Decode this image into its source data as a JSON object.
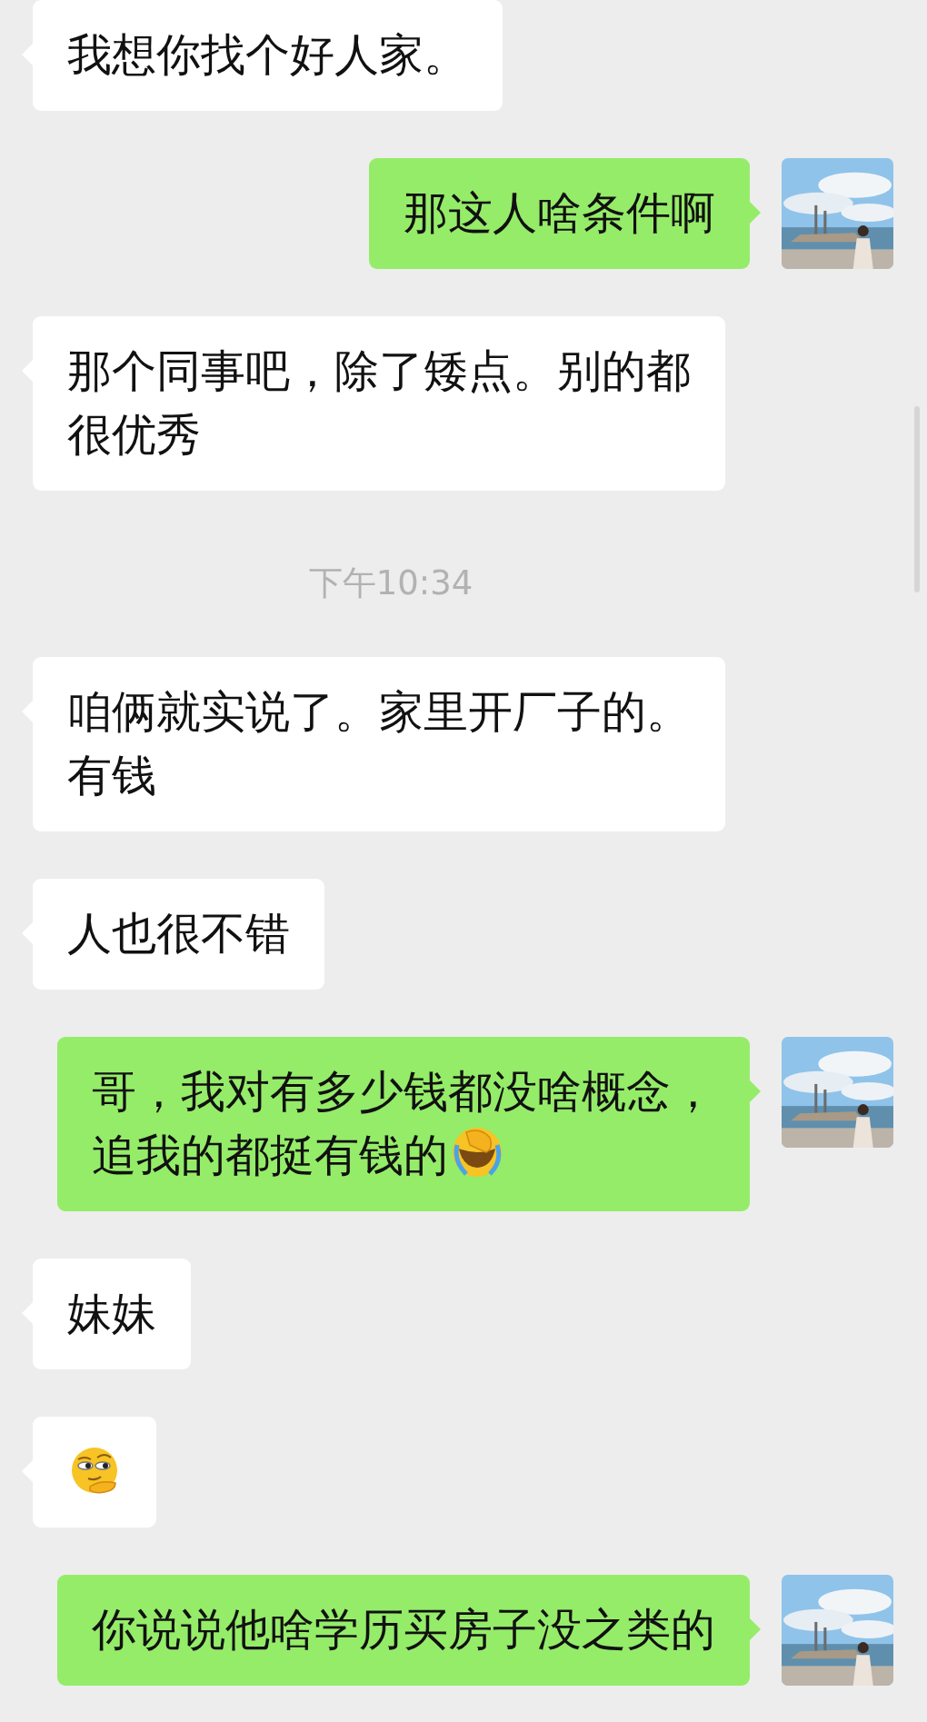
{
  "messages": [
    {
      "kind": "incoming",
      "lines": [
        "我想你找个好人家。"
      ]
    },
    {
      "kind": "outgoing",
      "lines": [
        "那这人啥条件啊"
      ]
    },
    {
      "kind": "incoming",
      "lines": [
        "那个同事吧，除了矮点。别的都",
        "很优秀"
      ]
    },
    {
      "kind": "time",
      "text": "下午10:34"
    },
    {
      "kind": "incoming",
      "lines": [
        "咱俩就实说了。家里开厂子的。",
        "有钱"
      ]
    },
    {
      "kind": "incoming",
      "lines": [
        "人也很不错"
      ]
    },
    {
      "kind": "outgoing",
      "lines": [
        "哥，我对有多少钱都没啥概念，",
        "追我的都挺有钱的"
      ],
      "emoji": {
        "kind": "facepalm"
      }
    },
    {
      "kind": "incoming",
      "lines": [
        "妹妹"
      ]
    },
    {
      "kind": "incoming",
      "emoji": {
        "kind": "smirk"
      }
    },
    {
      "kind": "outgoing",
      "lines": [
        "你说说他啥学历买房子没之类的"
      ]
    }
  ]
}
